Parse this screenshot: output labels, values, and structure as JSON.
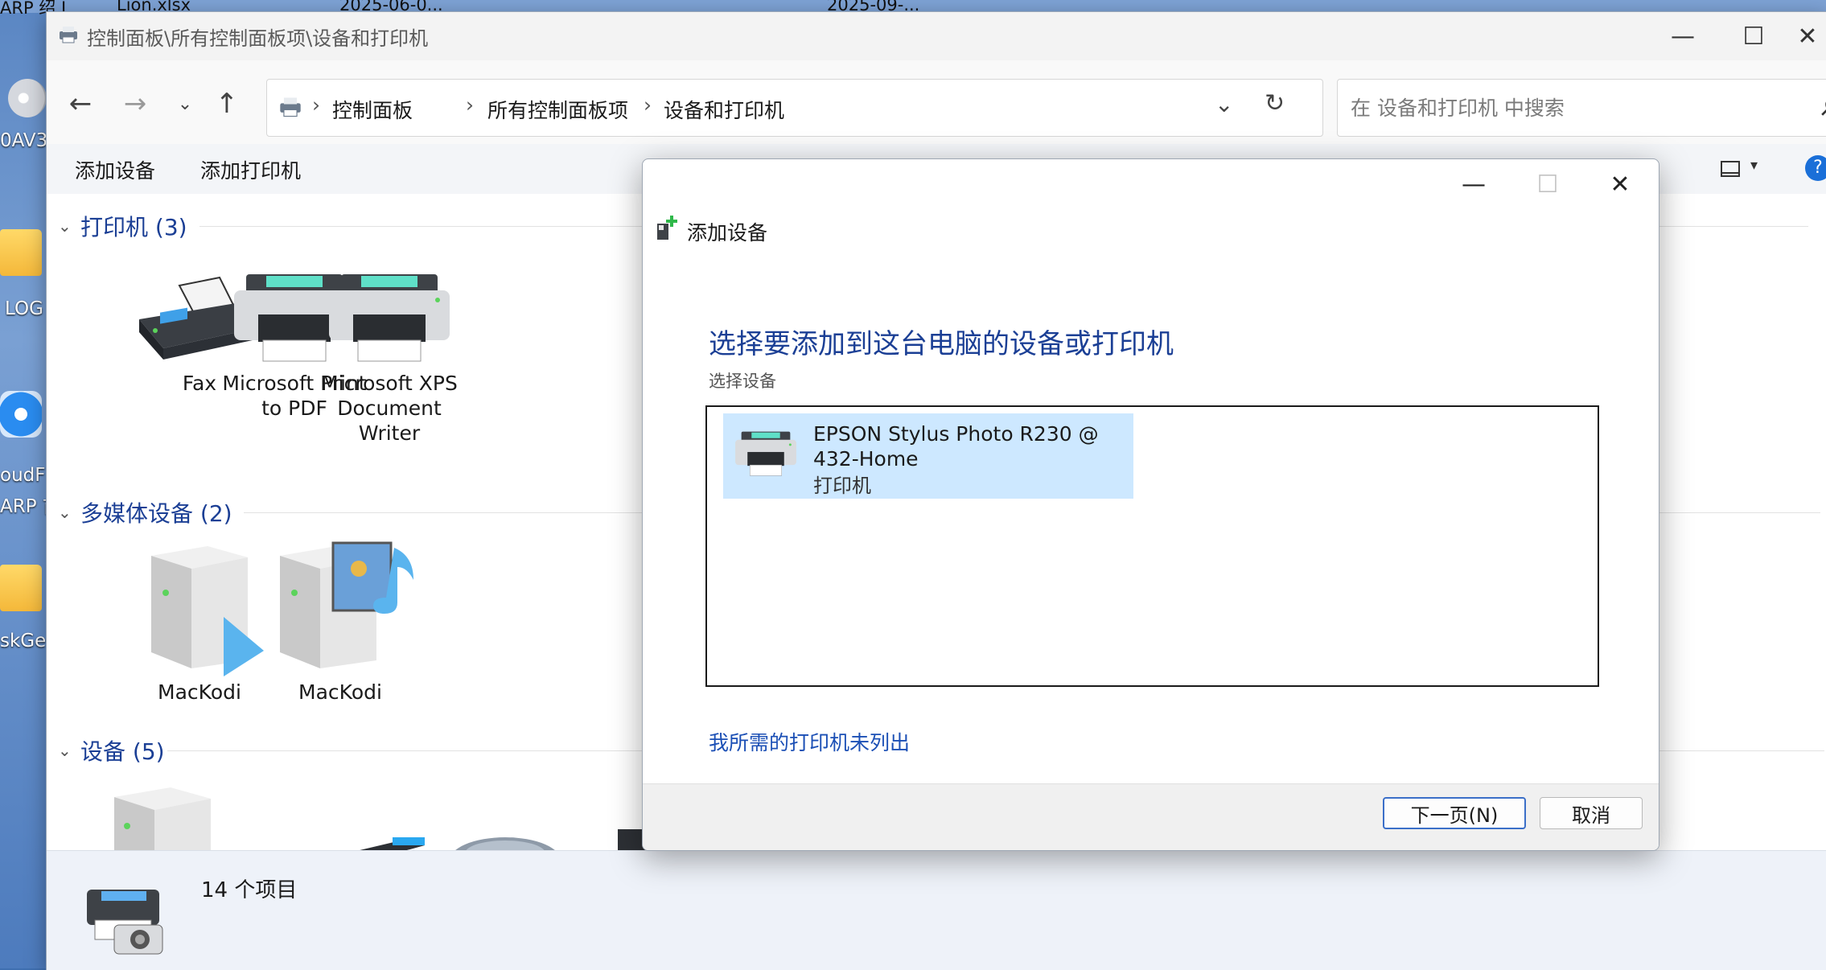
{
  "desktop": {
    "top_labels": [
      "ARP 绍 L...",
      "Lion.xlsx",
      "2025-06-0...",
      "2025-09-..."
    ],
    "icons": [
      {
        "name": "disc",
        "caption": "0AV3"
      },
      {
        "name": "folder",
        "caption": "LOG"
      },
      {
        "name": "safari",
        "caption": "oudF"
      },
      {
        "name": "safari2",
        "caption": "ARP 首"
      },
      {
        "name": "folder2",
        "caption": "skGe"
      }
    ]
  },
  "window": {
    "title": "控制面板\\所有控制面板项\\设备和打印机",
    "breadcrumb": [
      "控制面板",
      "所有控制面板项",
      "设备和打印机"
    ],
    "search_placeholder": "在 设备和打印机 中搜索",
    "commands": {
      "add_device": "添加设备",
      "add_printer": "添加打印机"
    },
    "groups": {
      "printers": {
        "title": "打印机 (3)",
        "items": [
          "Fax",
          "Microsoft Print to PDF",
          "Microsoft XPS Document Writer"
        ]
      },
      "media": {
        "title": "多媒体设备 (2)",
        "items": [
          "MacKodi",
          "MacKodi"
        ]
      },
      "devices": {
        "title": "设备 (5)"
      }
    },
    "status": {
      "count": "14 个项目"
    }
  },
  "dialog": {
    "title": "添加设备",
    "heading": "选择要添加到这台电脑的设备或打印机",
    "subtitle": "选择设备",
    "device": {
      "name": "EPSON Stylus Photo R230 @ 432-Home",
      "type": "打印机"
    },
    "link": "我所需的打印机未列出",
    "next_button": "下一页(N)",
    "cancel_button": "取消"
  },
  "colors": {
    "accent": "#1b3f95",
    "selection": "#cde8ff",
    "link": "#1b4fb5"
  }
}
